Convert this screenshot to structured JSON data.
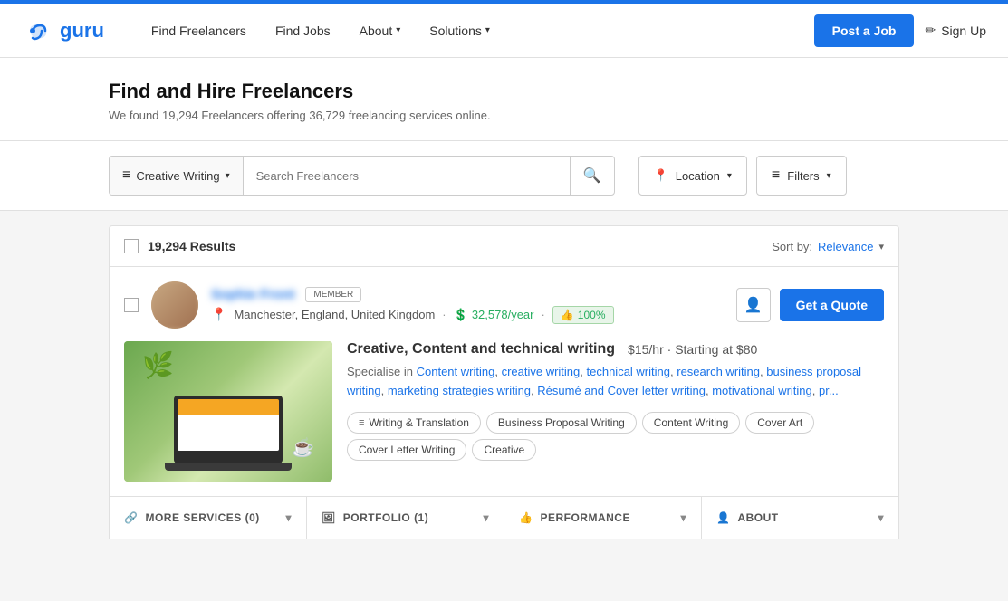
{
  "topbar": {},
  "header": {
    "logo_text": "guru",
    "nav": {
      "find_freelancers": "Find Freelancers",
      "find_jobs": "Find Jobs",
      "about": "About",
      "about_chevron": "▾",
      "solutions": "Solutions",
      "solutions_chevron": "▾"
    },
    "actions": {
      "post_job": "Post a Job",
      "sign_up": "Sign Up",
      "sign_up_icon": "✏"
    }
  },
  "hero": {
    "title": "Find and Hire Freelancers",
    "subtitle": "We found 19,294 Freelancers offering 36,729 freelancing services online."
  },
  "search": {
    "category": "Creative Writing",
    "category_icon": "≡",
    "placeholder": "Search Freelancers",
    "location_label": "Location",
    "location_icon": "📍",
    "filters_label": "Filters",
    "filters_icon": "≡"
  },
  "results": {
    "count_label": "19,294 Results",
    "sort_label": "Sort by:",
    "sort_value": "Relevance"
  },
  "freelancer": {
    "name": "Sophie Front",
    "member_badge": "MEMBER",
    "location": "Manchester, England, United Kingdom",
    "earnings": "32,578/year",
    "rating": "100%",
    "rating_icon": "👍",
    "add_icon": "👤+",
    "quote_btn": "Get a Quote",
    "service_title": "Creative, Content and technical writing",
    "service_rate": "$15/hr",
    "service_starting": "Starting at $80",
    "description_text": "Specialise in ",
    "description_links": [
      "Content writing",
      "creative writing",
      "technical writing",
      "research writing",
      "business proposal writing",
      "marketing strategies writing",
      "Résumé and Cover letter writing",
      "motivational writing",
      "pr..."
    ],
    "tags": [
      {
        "icon": "≡",
        "label": "Writing & Translation"
      },
      {
        "icon": "",
        "label": "Business Proposal Writing"
      },
      {
        "icon": "",
        "label": "Content Writing"
      },
      {
        "icon": "",
        "label": "Cover Art"
      },
      {
        "icon": "",
        "label": "Cover Letter Writing"
      },
      {
        "icon": "",
        "label": "Creative"
      }
    ]
  },
  "expand_bars": [
    {
      "icon": "🔗",
      "label": "MORE SERVICES (0)"
    },
    {
      "icon": "🖼",
      "label": "PORTFOLIO (1)"
    },
    {
      "icon": "👍",
      "label": "PERFORMANCE"
    },
    {
      "icon": "👤",
      "label": "ABOUT"
    }
  ]
}
